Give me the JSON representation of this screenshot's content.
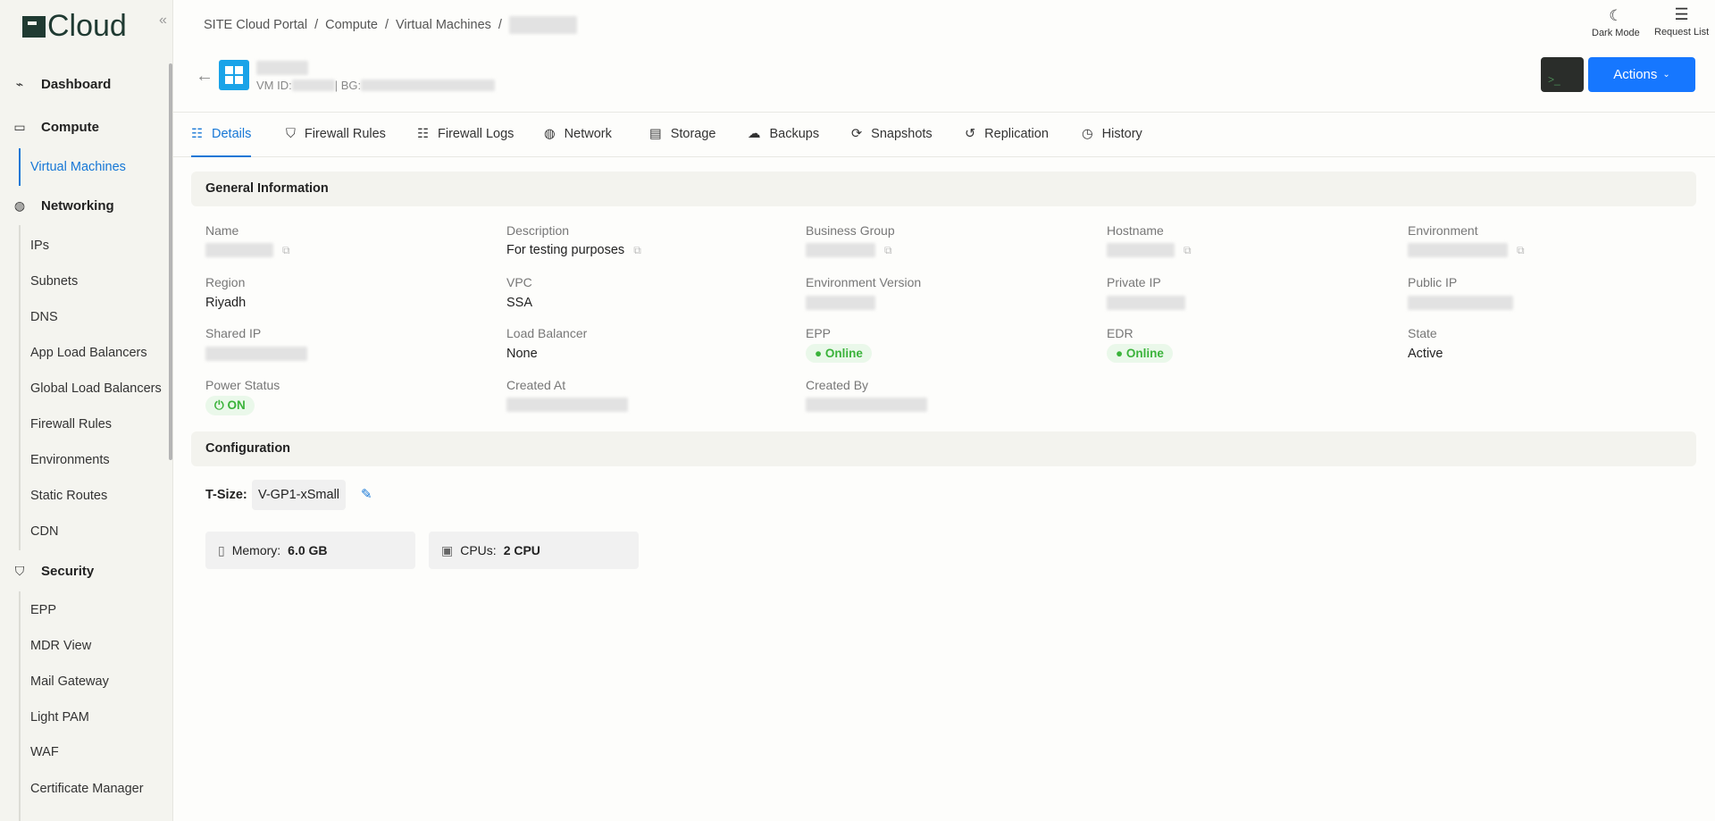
{
  "logo": "Cloud",
  "sidebar": {
    "groups": [
      {
        "label": "Dashboard",
        "icon": "chart-line-icon"
      },
      {
        "label": "Compute",
        "icon": "monitor-icon"
      },
      {
        "label": "Networking",
        "icon": "globe-icon"
      },
      {
        "label": "Security",
        "icon": "shield-icon"
      }
    ],
    "compute": [
      "Virtual Machines"
    ],
    "networking": [
      "IPs",
      "Subnets",
      "DNS",
      "App Load Balancers",
      "Global Load Balancers",
      "Firewall Rules",
      "Environments",
      "Static Routes",
      "CDN"
    ],
    "security": [
      "EPP",
      "MDR View",
      "Mail Gateway",
      "Light PAM",
      "WAF",
      "Certificate Manager"
    ]
  },
  "breadcrumb": [
    "SITE Cloud Portal",
    "Compute",
    "Virtual Machines"
  ],
  "top": {
    "dark_mode": "Dark Mode",
    "request_list": "Request List"
  },
  "vm": {
    "id_label": "VM ID:",
    "bg_label": "| BG:"
  },
  "actions_label": "Actions",
  "tabs": [
    "Details",
    "Firewall Rules",
    "Firewall Logs",
    "Network",
    "Storage",
    "Backups",
    "Snapshots",
    "Replication",
    "History"
  ],
  "general": {
    "title": "General Information",
    "fields": {
      "name": "Name",
      "description": "Description",
      "description_value": "For testing purposes",
      "business_group": "Business Group",
      "hostname": "Hostname",
      "environment": "Environment",
      "region": "Region",
      "region_value": "Riyadh",
      "vpc": "VPC",
      "vpc_value": "SSA",
      "env_version": "Environment Version",
      "private_ip": "Private IP",
      "public_ip": "Public IP",
      "shared_ip": "Shared IP",
      "load_balancer": "Load Balancer",
      "load_balancer_value": "None",
      "epp": "EPP",
      "epp_value": "Online",
      "edr": "EDR",
      "edr_value": "Online",
      "state": "State",
      "state_value": "Active",
      "power_status": "Power Status",
      "power_value": "ON",
      "created_at": "Created At",
      "created_by": "Created By"
    }
  },
  "config": {
    "title": "Configuration",
    "tsize_label": "T-Size:",
    "tsize_value": "V-GP1-xSmall",
    "memory_label": "Memory:",
    "memory_value": "6.0 GB",
    "cpu_label": "CPUs:",
    "cpu_value": "2 CPU"
  },
  "colors": {
    "accent": "#1677d6",
    "success": "#3bb33b",
    "sidebar_bg": "#f4f4ef"
  }
}
